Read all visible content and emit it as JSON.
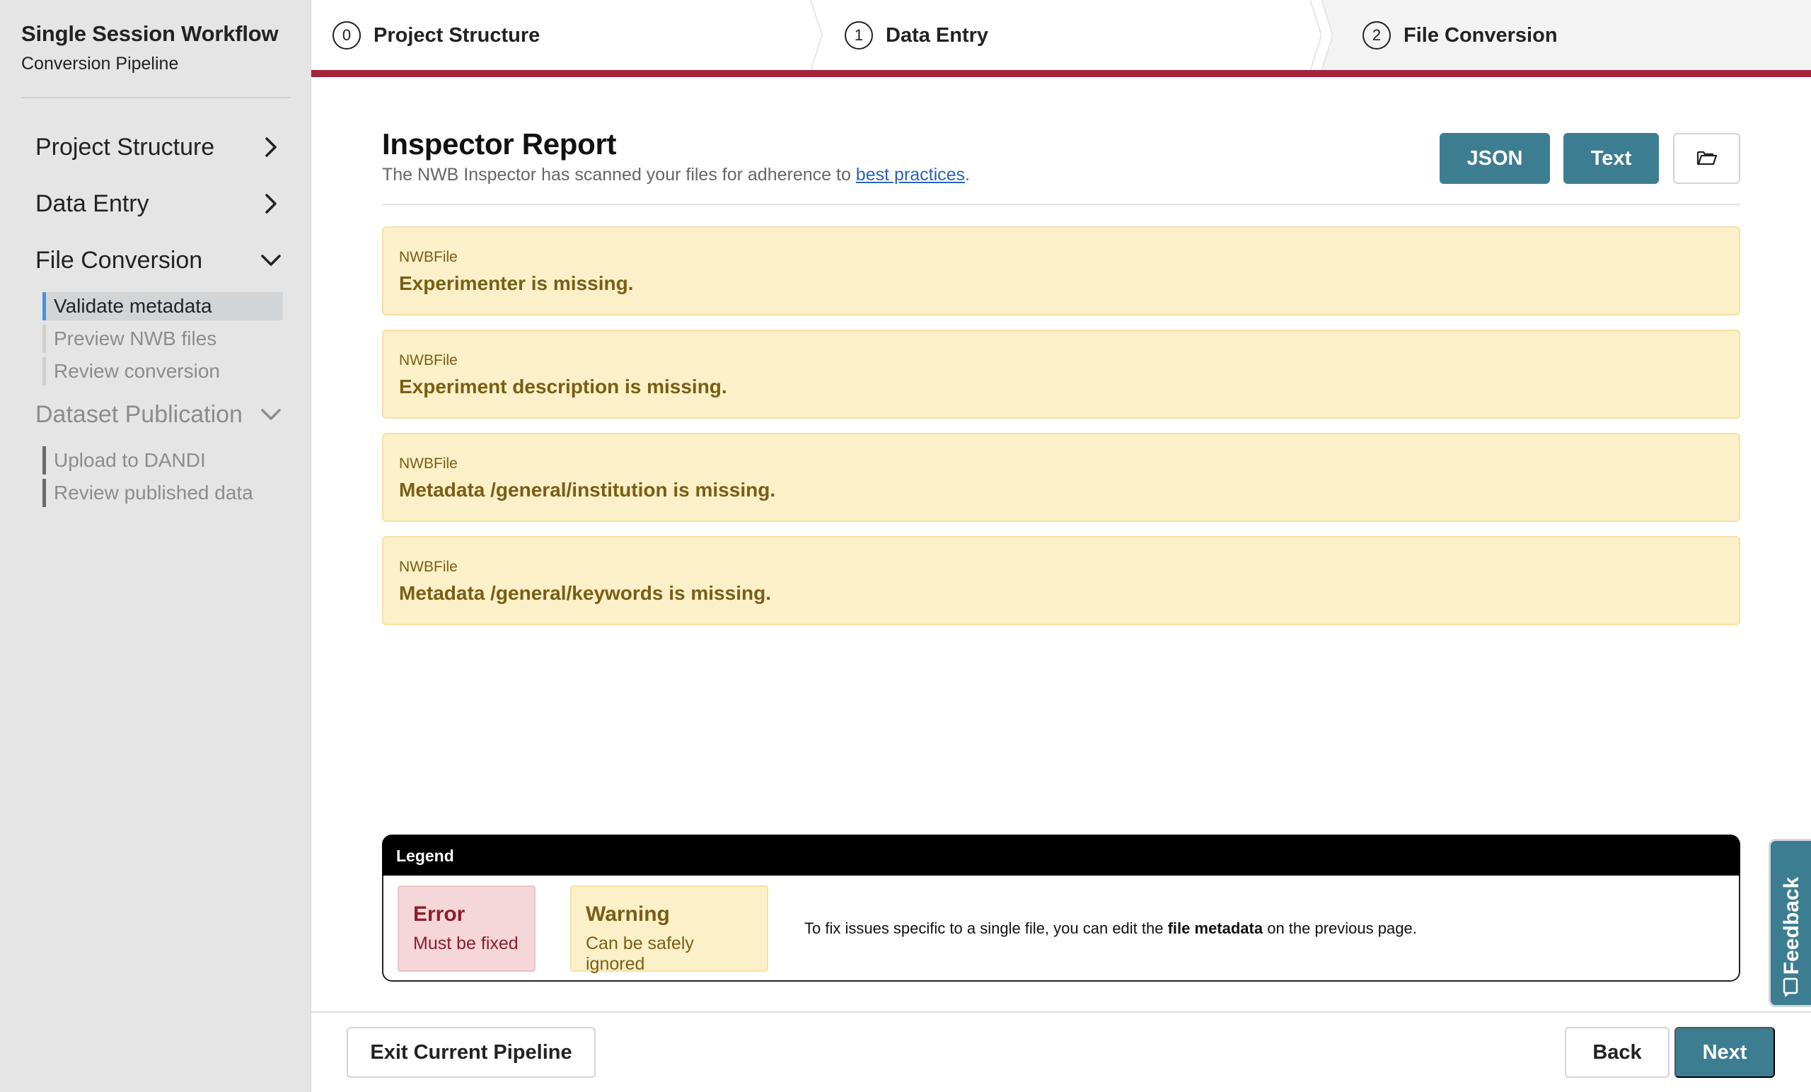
{
  "sidebar": {
    "title": "Single Session Workflow",
    "subtitle": "Conversion Pipeline",
    "sections": [
      {
        "label": "Project Structure",
        "state": "collapsed"
      },
      {
        "label": "Data Entry",
        "state": "collapsed"
      },
      {
        "label": "File Conversion",
        "state": "expanded",
        "items": [
          {
            "label": "Validate metadata",
            "active": true
          },
          {
            "label": "Preview NWB files",
            "active": false
          },
          {
            "label": "Review conversion",
            "active": false
          }
        ]
      },
      {
        "label": "Dataset Publication",
        "state": "expanded",
        "disabled": true,
        "items": [
          {
            "label": "Upload to DANDI"
          },
          {
            "label": "Review published data"
          }
        ]
      }
    ]
  },
  "stepper": {
    "steps": [
      {
        "number": "0",
        "label": "Project Structure"
      },
      {
        "number": "1",
        "label": "Data Entry"
      },
      {
        "number": "2",
        "label": "File Conversion"
      }
    ],
    "accent_color": "#a3243b"
  },
  "report": {
    "title": "Inspector Report",
    "subtitle_before": "The NWB Inspector has scanned your files for adherence to ",
    "subtitle_link": "best practices",
    "subtitle_after": ".",
    "buttons": {
      "json": "JSON",
      "text": "Text",
      "folder_icon": "folder-open-icon"
    },
    "messages": [
      {
        "object": "NWBFile",
        "message": "Experimenter is missing."
      },
      {
        "object": "NWBFile",
        "message": "Experiment description is missing."
      },
      {
        "object": "NWBFile",
        "message": "Metadata /general/institution is missing."
      },
      {
        "object": "NWBFile",
        "message": "Metadata /general/keywords is missing."
      }
    ]
  },
  "legend": {
    "title": "Legend",
    "error": {
      "title": "Error",
      "subtitle": "Must be fixed"
    },
    "warning": {
      "title": "Warning",
      "subtitle": "Can be safely ignored"
    },
    "note_before": "To fix issues specific to a single file, you can edit the ",
    "note_bold": "file metadata",
    "note_after": " on the previous page."
  },
  "footer": {
    "exit": "Exit Current Pipeline",
    "back": "Back",
    "next": "Next"
  },
  "feedback": {
    "label": "Feedback"
  },
  "colors": {
    "primary": "#3d7d91",
    "warning_bg": "#fcf0c8",
    "warning_text": "#7a5e16",
    "error_bg": "#f5d6d9",
    "error_text": "#8b1e2b",
    "sidebar_bg": "#e5e5e5"
  }
}
